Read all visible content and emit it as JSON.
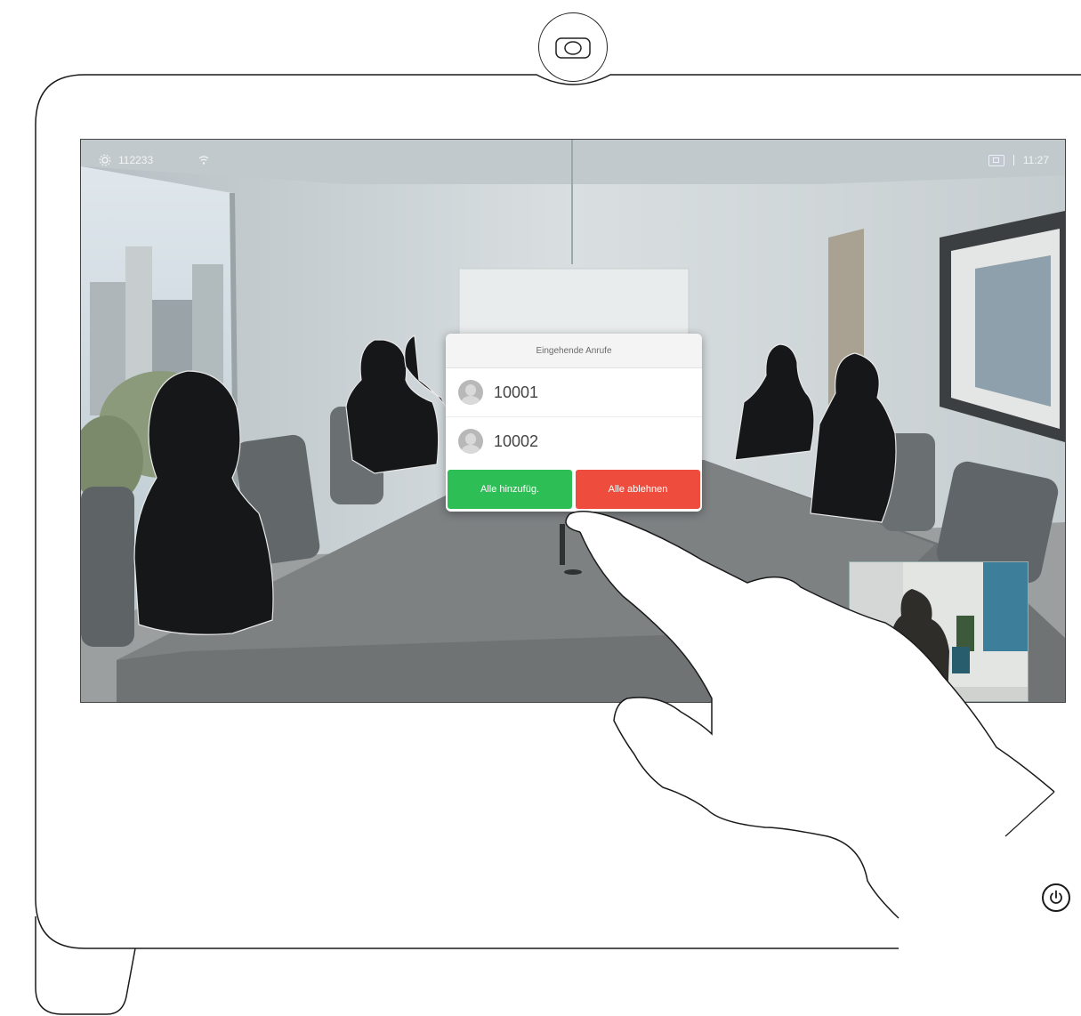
{
  "status_bar": {
    "settings_icon": "gear-icon",
    "id": "112233",
    "wifi_icon": "wifi-icon",
    "layout_icon": "layout-icon",
    "time": "11:27"
  },
  "incoming_dialog": {
    "title": "Eingehende Anrufe",
    "calls": [
      {
        "number": "10001",
        "icon": "avatar-icon"
      },
      {
        "number": "10002",
        "icon": "avatar-icon"
      }
    ],
    "accept_label": "Alle hinzufüg.",
    "decline_label": "Alle ablehnen"
  },
  "device": {
    "camera_icon": "camera-icon",
    "power_icon": "power-icon"
  },
  "colors": {
    "accept": "#2dbf55",
    "decline": "#ee4c3c",
    "outline": "#1a1a1a"
  }
}
